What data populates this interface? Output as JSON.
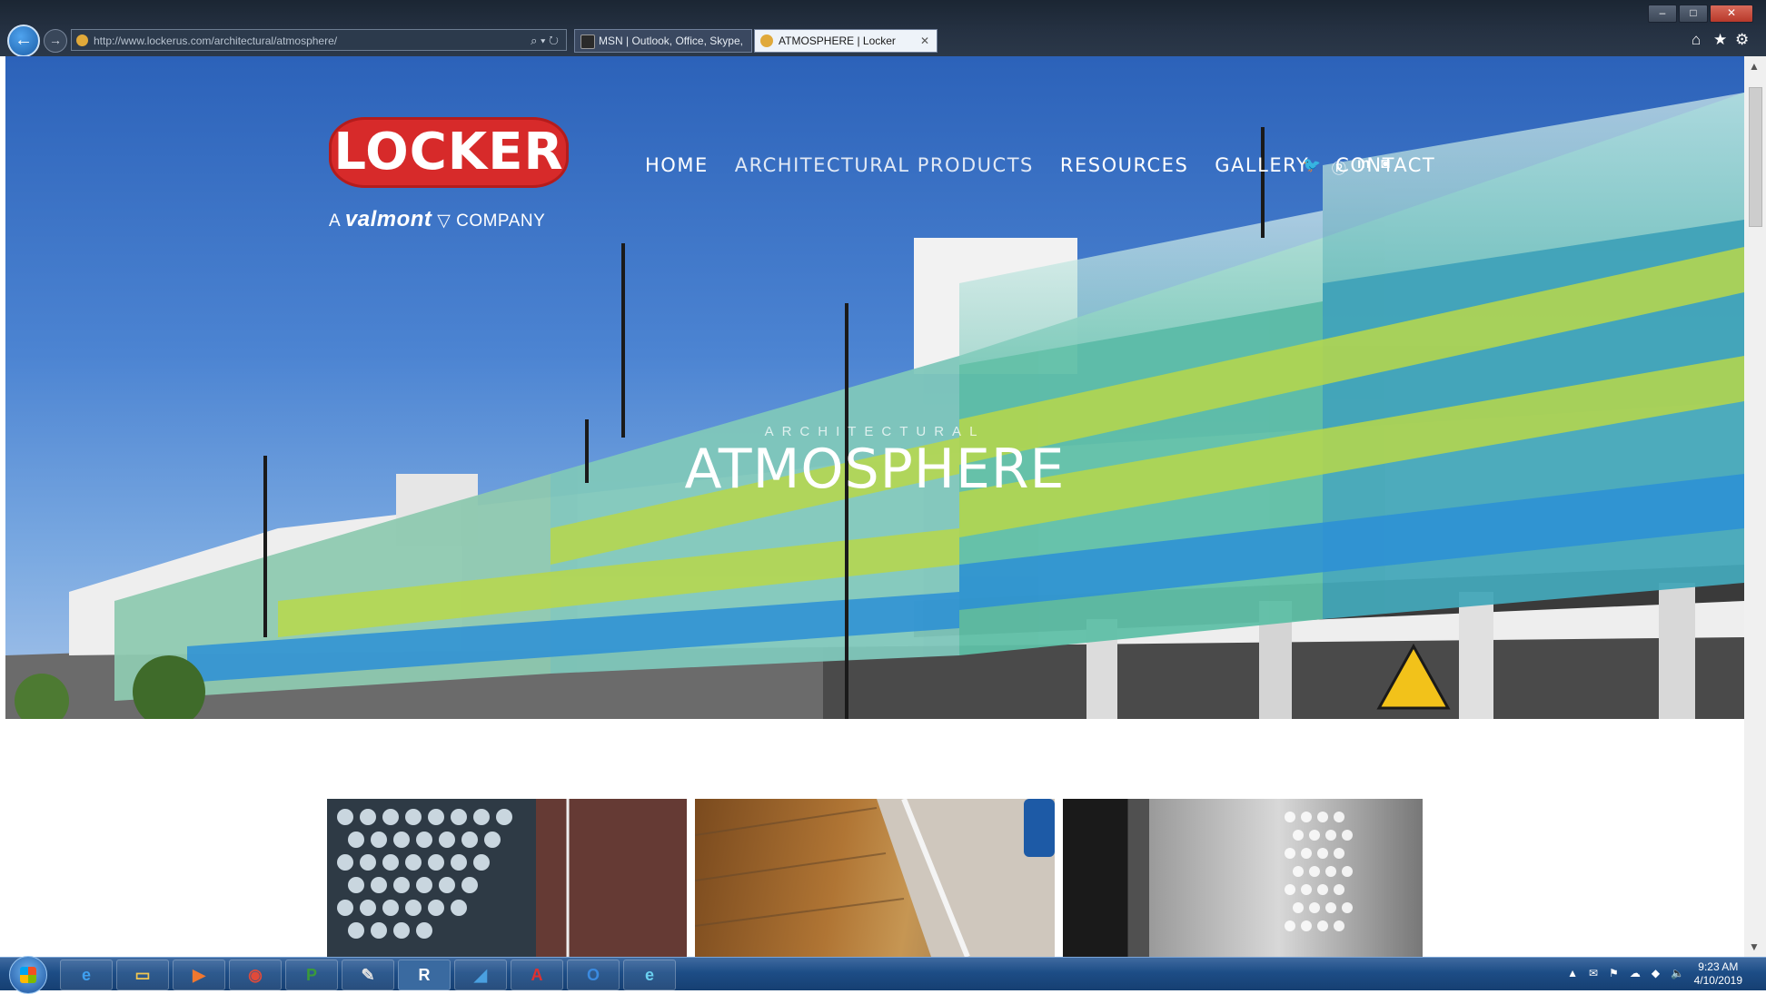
{
  "browser": {
    "url": "http://www.lockerus.com/architectural/atmosphere/",
    "tabs": [
      {
        "label": "MSN | Outlook, Office, Skype, ..."
      },
      {
        "label": "ATMOSPHERE | Locker"
      }
    ],
    "window_controls": {
      "minimize": "–",
      "maximize": "□",
      "close": "✕"
    }
  },
  "site": {
    "logo_text": "LOCKER",
    "tagline_prefix": "A",
    "tagline_brand": "valmont",
    "tagline_suffix": "COMPANY",
    "nav": [
      "HOME",
      "ARCHITECTURAL PRODUCTS",
      "RESOURCES",
      "GALLERY",
      "CONTACT"
    ],
    "social_icons": [
      "twitter-icon",
      "pinterest-icon",
      "linkedin-icon",
      "instagram-icon"
    ]
  },
  "hero": {
    "subtitle": "ARCHITECTURAL",
    "title": "ATMOSPHERE"
  },
  "taskbar": {
    "apps": [
      "internet-explorer",
      "file-explorer",
      "media-player",
      "chrome",
      "project",
      "paint",
      "revit",
      "sketchup",
      "acrobat",
      "outlook",
      "edge"
    ],
    "time": "9:23 AM",
    "date": "4/10/2019"
  },
  "colors": {
    "logo_red": "#d72a2a",
    "sky_blue": "#2c62b9",
    "taskbar_blue": "#1d4d86"
  }
}
